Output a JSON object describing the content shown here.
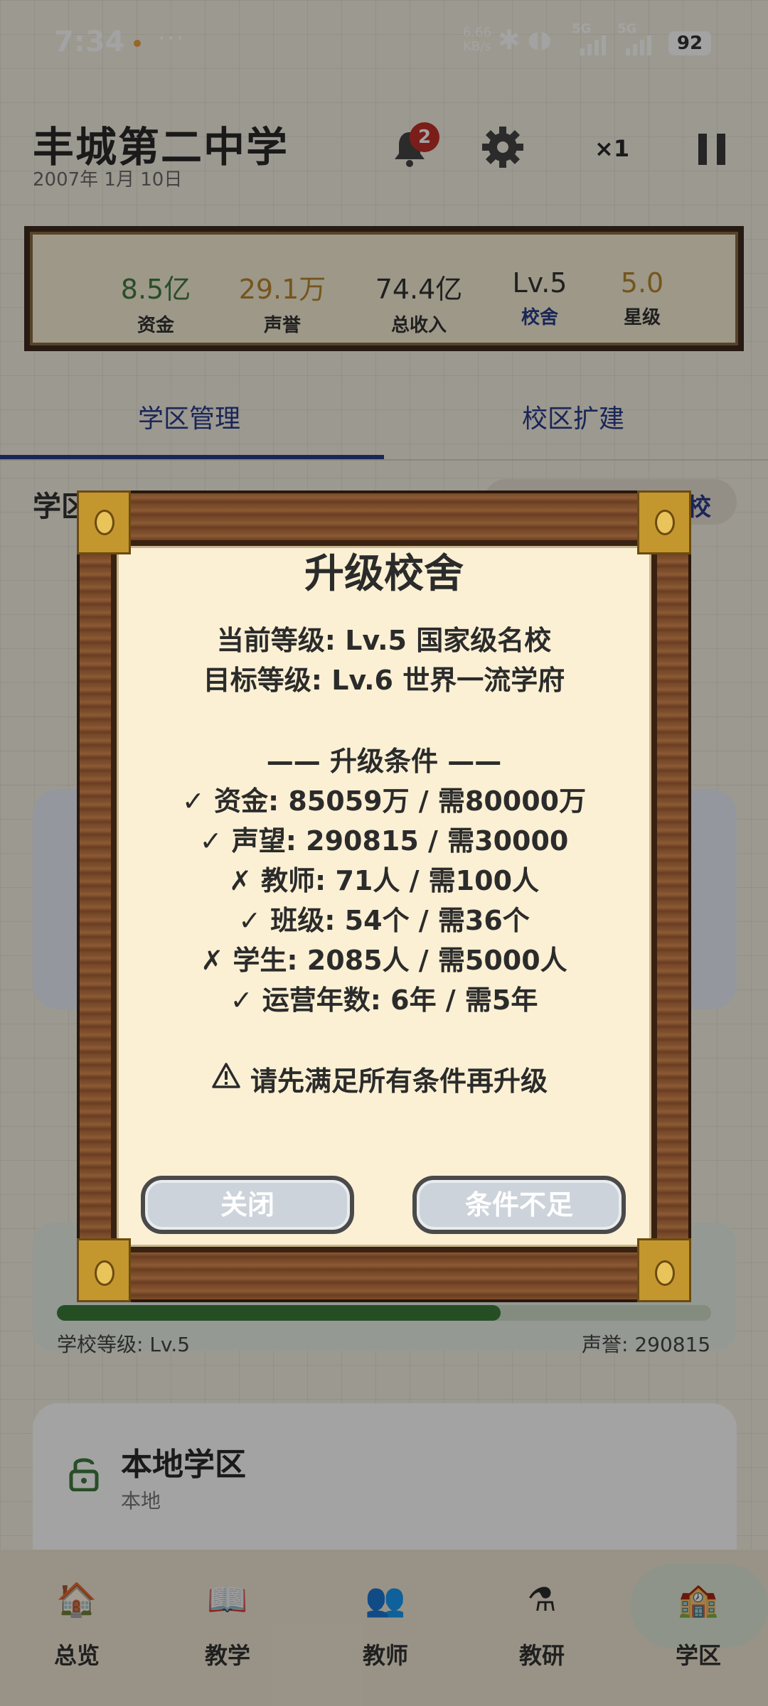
{
  "status_bar": {
    "time": "7:34",
    "more": "···",
    "net_speed": "6.66",
    "net_unit": "KB/s",
    "signal1_tag": "5G",
    "signal2_tag": "5G",
    "battery": "92"
  },
  "header": {
    "school_name": "丰城第二中学",
    "date": "2007年 1月 10日",
    "notification_count": "2",
    "speed": "×1"
  },
  "stats": [
    {
      "value": "8.5亿",
      "label": "资金",
      "color": "#3f7a3f"
    },
    {
      "value": "29.1万",
      "label": "声誉",
      "color": "#b8862c"
    },
    {
      "value": "74.4亿",
      "label": "总收入",
      "color": "#333333"
    },
    {
      "value": "Lv.5",
      "label": "校舍",
      "color": "#333333",
      "label_color": "#2a3a8a"
    },
    {
      "value": "5.0",
      "label": "星级",
      "color": "#b8862c"
    }
  ],
  "tabs": [
    {
      "label": "学区管理",
      "active": true
    },
    {
      "label": "校区扩建",
      "active": false
    }
  ],
  "background": {
    "section_head": "学区",
    "pill_text": "校",
    "level": "学校等级: Lv.5",
    "reputation": "声誉: 290815",
    "local_title": "本地学区",
    "local_sub": "本地"
  },
  "nav": [
    {
      "label": "总览",
      "icon": "school-building-icon",
      "glyph": "🏠"
    },
    {
      "label": "教学",
      "icon": "book-icon",
      "glyph": "📖"
    },
    {
      "label": "教师",
      "icon": "teachers-icon",
      "glyph": "👥"
    },
    {
      "label": "教研",
      "icon": "flask-icon",
      "glyph": "⚗"
    },
    {
      "label": "学区",
      "icon": "campus-icon",
      "glyph": "🏫",
      "active": true
    }
  ],
  "dialog": {
    "title": "升级校舍",
    "current_level": "当前等级: Lv.5 国家级名校",
    "target_level": "目标等级: Lv.6 世界一流学府",
    "conditions_header": "—— 升级条件 ——",
    "conditions": [
      "✓ 资金: 85059万 / 需80000万",
      "✓ 声望: 290815 / 需30000",
      "✗ 教师: 71人 / 需100人",
      "✓ 班级: 54个 / 需36个",
      "✗ 学生: 2085人 / 需5000人",
      "✓ 运营年数: 6年 / 需5年"
    ],
    "warning": "请先满足所有条件再升级",
    "close_label": "关闭",
    "confirm_label": "条件不足"
  }
}
